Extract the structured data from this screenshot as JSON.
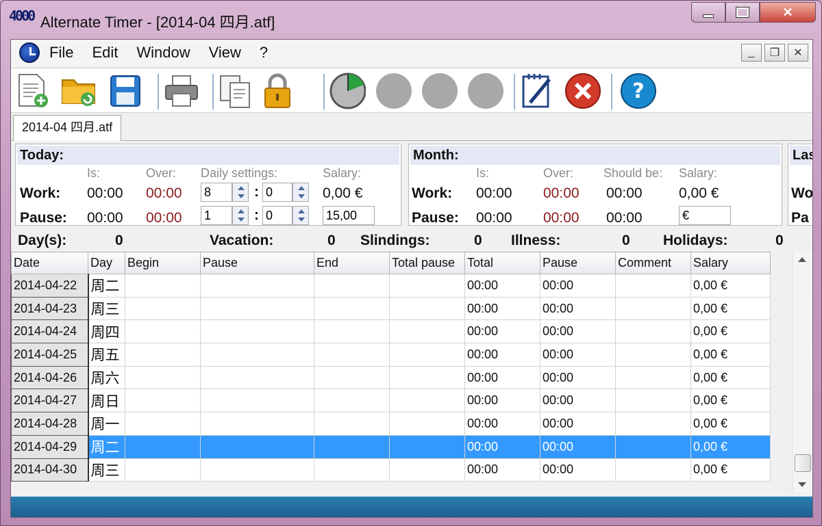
{
  "window": {
    "title": "Alternate Timer - [2014-04 四月.atf]",
    "icon_text": "4000"
  },
  "menu": [
    "File",
    "Edit",
    "Window",
    "View",
    "?"
  ],
  "toolbar": [
    {
      "name": "new-file-icon",
      "color": "#49a84a"
    },
    {
      "name": "open-folder-icon",
      "color": "#e8a512"
    },
    {
      "name": "save-icon",
      "color": "#2a7cd0"
    },
    {
      "name": "print-icon",
      "color": "#6a6a6a"
    },
    {
      "name": "copy-icon",
      "color": "#6a6a6a"
    },
    {
      "name": "lock-icon",
      "color": "#e8a512"
    },
    {
      "name": "pie-timer-icon",
      "color": "#2aa040"
    },
    {
      "name": "disabled-circle-icon",
      "color": "#a8a8a8"
    },
    {
      "name": "disabled-circle-icon",
      "color": "#a8a8a8"
    },
    {
      "name": "disabled-circle-icon",
      "color": "#a8a8a8"
    },
    {
      "name": "notepad-icon",
      "color": "#2a4a8a"
    },
    {
      "name": "cancel-icon",
      "color": "#d23a2a"
    },
    {
      "name": "help-icon",
      "color": "#1a8ad0"
    }
  ],
  "tab": "2014-04 四月.atf",
  "today": {
    "title": "Today:",
    "col_is": "Is:",
    "col_over": "Over:",
    "col_daily": "Daily settings:",
    "col_salary": "Salary:",
    "work_label": "Work:",
    "work_is": "00:00",
    "work_over": "00:00",
    "work_h": "8",
    "work_m": "0",
    "work_salary": "0,00 €",
    "pause_label": "Pause:",
    "pause_is": "00:00",
    "pause_over": "00:00",
    "pause_h": "1",
    "pause_m": "0",
    "pause_salary": "15,00",
    "sep": ":"
  },
  "month": {
    "title": "Month:",
    "col_is": "Is:",
    "col_over": "Over:",
    "col_should": "Should be:",
    "col_salary": "Salary:",
    "work_label": "Work:",
    "work_is": "00:00",
    "work_over": "00:00",
    "work_should": "00:00",
    "work_salary": "0,00 €",
    "pause_label": "Pause:",
    "pause_is": "00:00",
    "pause_over": "00:00",
    "pause_should": "00:00",
    "pause_salary": "€"
  },
  "last": {
    "title": "Las",
    "work_label": "Wo",
    "pause_label": "Pa"
  },
  "summary": {
    "days_label": "Day(s):",
    "days": "0",
    "vacation_label": "Vacation:",
    "vacation": "0",
    "slindings_label": "Slindings:",
    "slindings": "0",
    "illness_label": "Illness:",
    "illness": "0",
    "holidays_label": "Holidays:",
    "holidays": "0"
  },
  "grid": {
    "columns": [
      "Date",
      "Day",
      "Begin",
      "Pause",
      "End",
      "Total pause",
      "Total",
      "Pause",
      "Comment",
      "Salary"
    ],
    "rows": [
      {
        "date": "2014-04-22",
        "day": "周二",
        "total": "00:00",
        "pause": "00:00",
        "salary": "0,00 €"
      },
      {
        "date": "2014-04-23",
        "day": "周三",
        "total": "00:00",
        "pause": "00:00",
        "salary": "0,00 €"
      },
      {
        "date": "2014-04-24",
        "day": "周四",
        "total": "00:00",
        "pause": "00:00",
        "salary": "0,00 €"
      },
      {
        "date": "2014-04-25",
        "day": "周五",
        "total": "00:00",
        "pause": "00:00",
        "salary": "0,00 €"
      },
      {
        "date": "2014-04-26",
        "day": "周六",
        "total": "00:00",
        "pause": "00:00",
        "salary": "0,00 €"
      },
      {
        "date": "2014-04-27",
        "day": "周日",
        "total": "00:00",
        "pause": "00:00",
        "salary": "0,00 €"
      },
      {
        "date": "2014-04-28",
        "day": "周一",
        "total": "00:00",
        "pause": "00:00",
        "salary": "0,00 €"
      },
      {
        "date": "2014-04-29",
        "day": "周二",
        "total": "00:00",
        "pause": "00:00",
        "salary": "0,00 €",
        "selected": true
      },
      {
        "date": "2014-04-30",
        "day": "周三",
        "total": "00:00",
        "pause": "00:00",
        "salary": "0,00 €"
      }
    ]
  },
  "colors": {
    "selection": "#3399ff",
    "status_bar": "#2a7fb0",
    "over_value": "#8b1a1a"
  }
}
